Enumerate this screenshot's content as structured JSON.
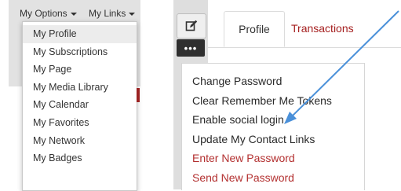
{
  "left_panel": {
    "top_menu": [
      {
        "label": "My Options"
      },
      {
        "label": "My Links"
      }
    ],
    "dropdown_items": [
      {
        "label": "My Profile"
      },
      {
        "label": "My Subscriptions"
      },
      {
        "label": "My Page"
      },
      {
        "label": "My Media Library"
      },
      {
        "label": "My Calendar"
      },
      {
        "label": "My Favorites"
      },
      {
        "label": "My Network"
      },
      {
        "label": "My Badges"
      }
    ]
  },
  "right_panel": {
    "edit_icon": "edit-icon",
    "more_label": "•••",
    "tabs": [
      {
        "label": "Profile"
      },
      {
        "label": "Transactions"
      }
    ],
    "menu_items": [
      {
        "label": "Change Password"
      },
      {
        "label": "Clear Remember Me Tokens"
      },
      {
        "label": "Enable social login"
      },
      {
        "label": "Update My Contact Links"
      },
      {
        "label": "Enter New Password"
      },
      {
        "label": "Send New Password"
      }
    ]
  },
  "colors": {
    "accent_red": "#a51f1f",
    "arrow_blue": "#4a90d9",
    "panel_gray": "#e2e2e2"
  }
}
